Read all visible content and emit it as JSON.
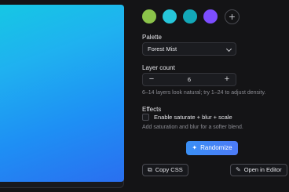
{
  "palette_swatches": [
    {
      "name": "lime",
      "color": "#8bc34a"
    },
    {
      "name": "cyan",
      "color": "#26c6da"
    },
    {
      "name": "teal",
      "color": "#13a8b8"
    },
    {
      "name": "violet",
      "color": "#7c4dff"
    }
  ],
  "add_swatch_icon": "plus-icon",
  "palette": {
    "label": "Palette",
    "selected": "Forest Mist"
  },
  "layer_count": {
    "label": "Layer count",
    "value": "6",
    "decrement": "−",
    "increment": "+",
    "hint": "6–14 layers look natural; try 1–24 to adjust density."
  },
  "effects": {
    "label": "Effects",
    "checkbox_label": "Enable saturate + blur + scale",
    "checked": false,
    "hint": "Add saturation and blur for a softer blend."
  },
  "actions": {
    "randomize": "Randomize",
    "copy_css": "Copy CSS",
    "open_editor": "Open in Editor"
  },
  "preview_gradient": [
    "#16c7e4",
    "#1fb1f0",
    "#1e8ff4",
    "#2a6ff0"
  ]
}
